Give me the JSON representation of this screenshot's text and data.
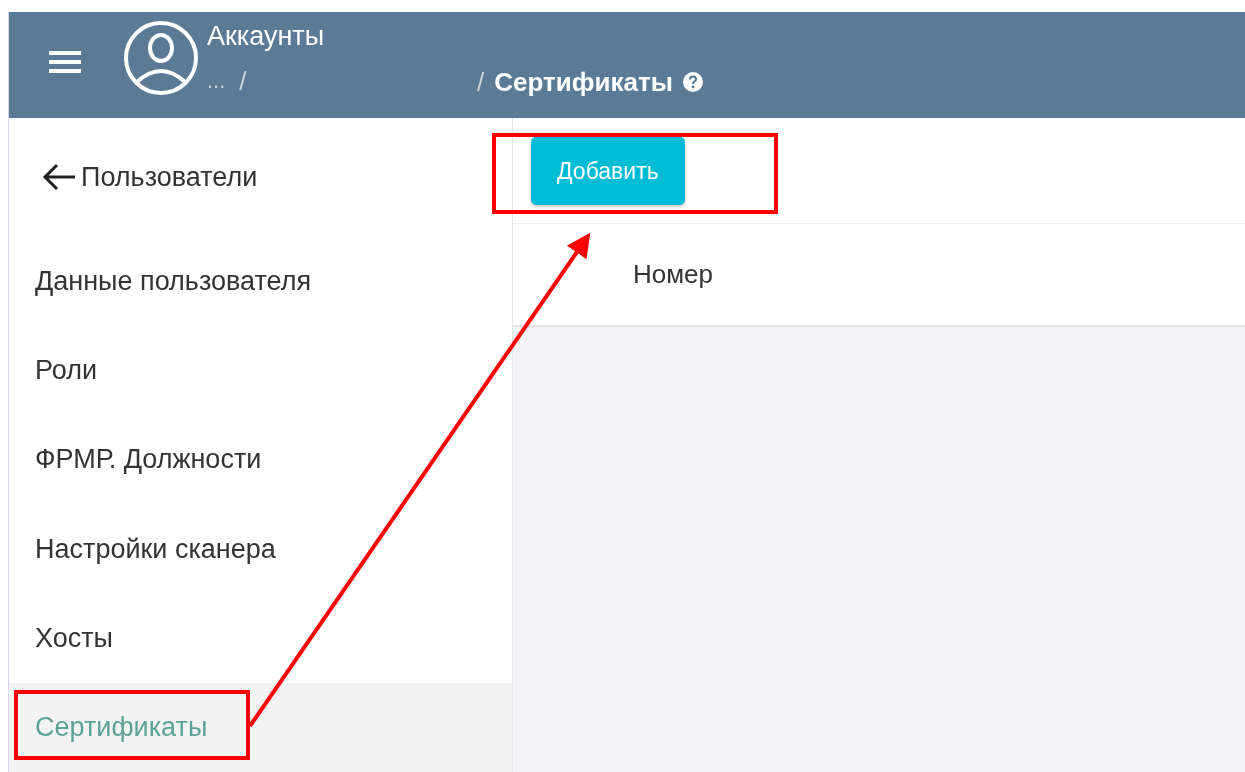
{
  "header": {
    "title": "Аккаунты",
    "breadcrumb": [
      {
        "kind": "ellipsis",
        "text": "..."
      },
      {
        "kind": "separator",
        "text": "/"
      },
      {
        "kind": "separator",
        "text": "/"
      },
      {
        "kind": "current",
        "text": "Сертификаты"
      }
    ]
  },
  "sidebar": {
    "back": {
      "label": "Пользователи"
    },
    "items": [
      {
        "label": "Данные пользователя",
        "selected": false
      },
      {
        "label": "Роли",
        "selected": false
      },
      {
        "label": "ФРМР. Должности",
        "selected": false
      },
      {
        "label": "Настройки сканера",
        "selected": false
      },
      {
        "label": "Хосты",
        "selected": false
      },
      {
        "label": "Сертификаты",
        "selected": true
      }
    ]
  },
  "toolbar": {
    "buttons": [
      "Добавить"
    ]
  },
  "table": {
    "columns": [
      "Номер"
    ]
  }
}
